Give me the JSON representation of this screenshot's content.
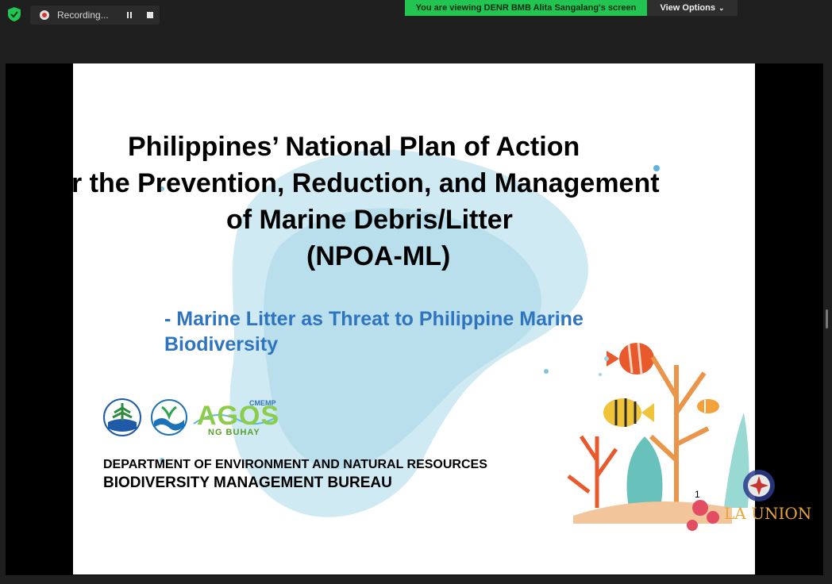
{
  "toolbar": {
    "recording_label": "Recording...",
    "viewing_banner": "You are viewing DENR BMB Alita Sangalang's screen",
    "view_options_label": "View Options",
    "view_options_chevron": "⌄"
  },
  "slide": {
    "title_lines": [
      "Philippines’  National Plan of Action",
      "r the Prevention, Reduction, and Management",
      "of Marine Debris/Litter",
      "(NPOA-ML)"
    ],
    "subtitle_lines": [
      "- Marine Litter as Threat to Philippine Marine",
      "Biodiversity"
    ],
    "agos_logo_text": "AGOS",
    "agos_logo_tag": "CMEMP",
    "agos_logo_sub": "NG BUHAY",
    "department": "DEPARTMENT OF ENVIRONMENT AND NATURAL RESOURCES",
    "bureau": "BIODIVERSITY MANAGEMENT BUREAU",
    "page_number": "1"
  },
  "watermark": {
    "text": "LA UNION"
  },
  "colors": {
    "banner_green": "#23c552",
    "subtitle_blue": "#2f74bf",
    "blob_blue": "#a9d8ea"
  }
}
